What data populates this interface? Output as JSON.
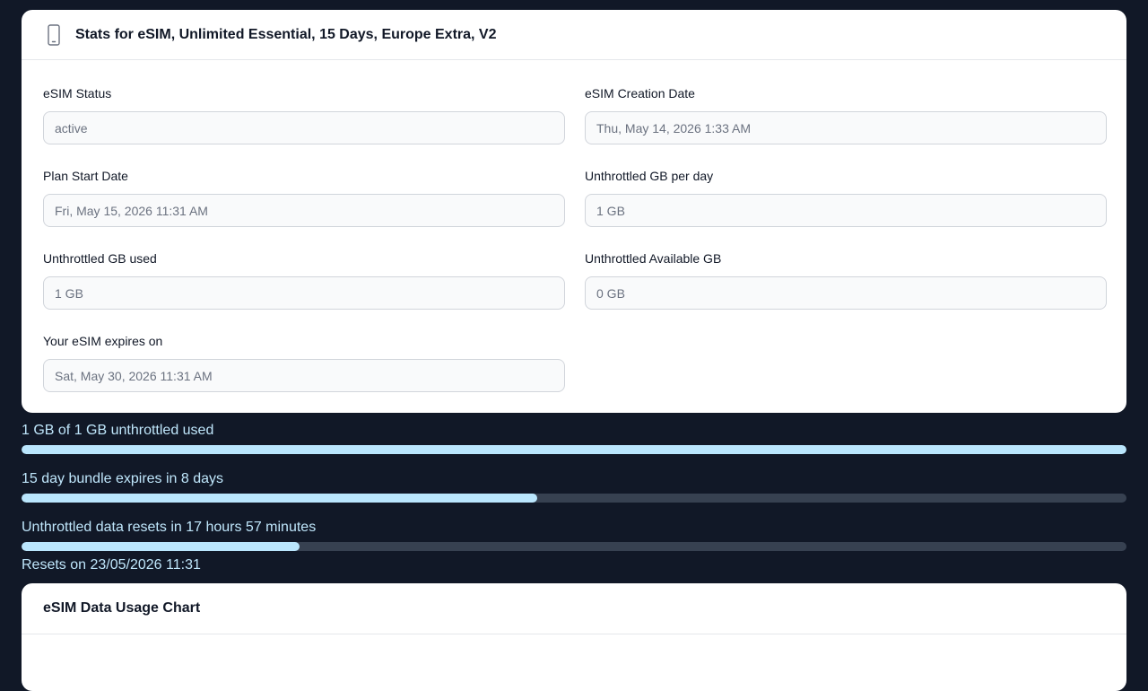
{
  "stats_card": {
    "icon": "phone-icon",
    "title": "Stats for eSIM, Unlimited Essential, 15 Days, Europe Extra, V2",
    "fields": {
      "status": {
        "label": "eSIM Status",
        "value": "active"
      },
      "creation_date": {
        "label": "eSIM Creation Date",
        "value": "Thu, May 14, 2026 1:33 AM"
      },
      "plan_start": {
        "label": "Plan Start Date",
        "value": "Fri, May 15, 2026 11:31 AM"
      },
      "gb_per_day": {
        "label": "Unthrottled GB per day",
        "value": "1 GB"
      },
      "gb_used": {
        "label": "Unthrottled GB used",
        "value": "1 GB"
      },
      "gb_available": {
        "label": "Unthrottled Available GB",
        "value": "0 GB"
      },
      "expires_on": {
        "label": "Your eSIM expires on",
        "value": "Sat, May 30, 2026 11:31 AM"
      }
    }
  },
  "progress": [
    {
      "label": "1 GB of 1 GB unthrottled used",
      "fraction": 1.0
    },
    {
      "label": "15 day bundle expires in 8 days",
      "fraction": 0.467
    },
    {
      "label": "Unthrottled data resets in 17 hours 57 minutes",
      "fraction": 0.252
    }
  ],
  "resets_on": "Resets on 23/05/2026 11:31",
  "chart_card": {
    "title": "eSIM Data Usage Chart"
  },
  "colors": {
    "background": "#111827",
    "progress_fill": "#bae6fd",
    "progress_track": "#374151",
    "label_text": "#bfe6fb"
  }
}
